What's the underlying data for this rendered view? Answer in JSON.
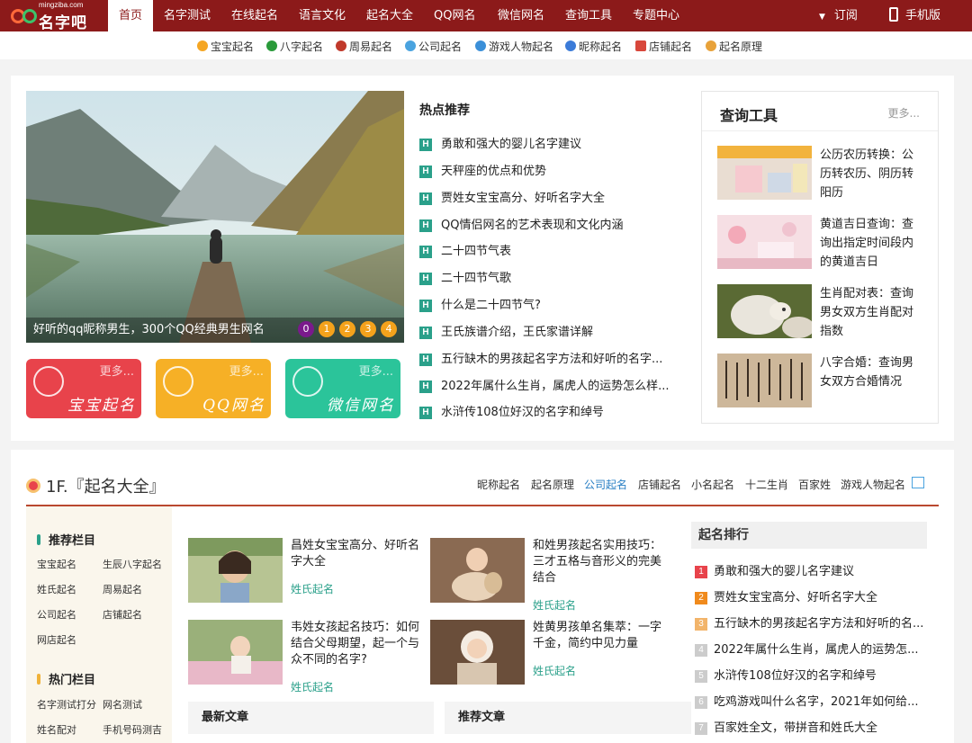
{
  "header": {
    "logo_domain": "mingziba.com",
    "logo_name": "名字吧",
    "nav": [
      "首页",
      "名字测试",
      "在线起名",
      "语言文化",
      "起名大全",
      "QQ网名",
      "微信网名",
      "查询工具",
      "专题中心"
    ],
    "subscribe": "订阅",
    "mobile": "手机版"
  },
  "subnav": [
    {
      "label": "宝宝起名",
      "icon": "baby-icon",
      "color": "#f5a623"
    },
    {
      "label": "八字起名",
      "icon": "eight-icon",
      "color": "#2a9a3a"
    },
    {
      "label": "周易起名",
      "icon": "person-icon",
      "color": "#c0392b"
    },
    {
      "label": "公司起名",
      "icon": "globe-icon",
      "color": "#4aa3df"
    },
    {
      "label": "游戏人物起名",
      "icon": "cloud-icon",
      "color": "#3b8fd8"
    },
    {
      "label": "昵称起名",
      "icon": "user-add-icon",
      "color": "#3b7bd8"
    },
    {
      "label": "店铺起名",
      "icon": "shop-icon",
      "color": "#d8473b"
    },
    {
      "label": "起名原理",
      "icon": "bulb-icon",
      "color": "#e8a23a"
    }
  ],
  "slider": {
    "caption": "好听的qq昵称男生，300个QQ经典男生网名",
    "dots": [
      "0",
      "1",
      "2",
      "3",
      "4"
    ],
    "current": 0
  },
  "tiles": [
    {
      "more": "更多...",
      "label": "宝宝起名",
      "color": "#e8434b"
    },
    {
      "more": "更多...",
      "label": "QQ网名",
      "color": "#f6b026"
    },
    {
      "more": "更多...",
      "label": "微信网名",
      "color": "#2bc49a"
    }
  ],
  "hot": {
    "title": "热点推荐",
    "badge": "H",
    "items": [
      "勇敢和强大的婴儿名字建议",
      "天秤座的优点和优势",
      "贾姓女宝宝高分、好听名字大全",
      "QQ情侣网名的艺术表现和文化内涵",
      "二十四节气表",
      "二十四节气歌",
      "什么是二十四节气?",
      "王氏族谱介绍，王氏家谱详解",
      "五行缺木的男孩起名字方法和好听的名字...",
      "2022年属什么生肖，属虎人的运势怎么样...",
      "水浒传108位好汉的名字和绰号"
    ]
  },
  "tools": {
    "title": "查询工具",
    "more": "更多...",
    "items": [
      "公历农历转换：公历转农历、阴历转阳历",
      "黄道吉日查询：查询出指定时间段内的黄道吉日",
      "生肖配对表：查询男女双方生肖配对指数",
      "八字合婚：查询男女双方合婚情况"
    ]
  },
  "section1": {
    "title": "1F.『起名大全』",
    "tabs": [
      "昵称起名",
      "起名原理",
      "公司起名",
      "店铺起名",
      "小名起名",
      "十二生肖",
      "百家姓",
      "游戏人物起名"
    ],
    "active_tab": 2
  },
  "leftpane": {
    "rec_title": "推荐栏目",
    "rec_links": [
      "宝宝起名",
      "生辰八字起名",
      "姓氏起名",
      "周易起名",
      "公司起名",
      "店铺起名",
      "网店起名"
    ],
    "hot_title": "热门栏目",
    "hot_links": [
      "名字测试打分",
      "网名测试",
      "姓名配对",
      "手机号码测吉"
    ]
  },
  "articles": [
    {
      "title": "昌姓女宝宝高分、好听名字大全",
      "tag": "姓氏起名"
    },
    {
      "title": "和姓男孩起名实用技巧：三才五格与音形义的完美结合",
      "tag": "姓氏起名"
    },
    {
      "title": "韦姓女孩起名技巧：如何结合父母期望，起一个与众不同的名字?",
      "tag": "姓氏起名"
    },
    {
      "title": "姓黄男孩单名集萃：一字千金，简约中见力量",
      "tag": "姓氏起名"
    }
  ],
  "subboxes": [
    "最新文章",
    "推荐文章"
  ],
  "ranking": {
    "title": "起名排行",
    "numbers": [
      "1",
      "2",
      "3",
      "4",
      "5",
      "6",
      "7"
    ],
    "colors": [
      "#e8434b",
      "#f08a1c",
      "#f2b46a",
      "#cccccc",
      "#cccccc",
      "#cccccc",
      "#cccccc"
    ],
    "items": [
      "勇敢和强大的婴儿名字建议",
      "贾姓女宝宝高分、好听名字大全",
      "五行缺木的男孩起名字方法和好听的名...",
      "2022年属什么生肖，属虎人的运势怎...",
      "水浒传108位好汉的名字和绰号",
      "吃鸡游戏叫什么名字，2021年如何给...",
      "百家姓全文，带拼音和姓氏大全"
    ]
  }
}
